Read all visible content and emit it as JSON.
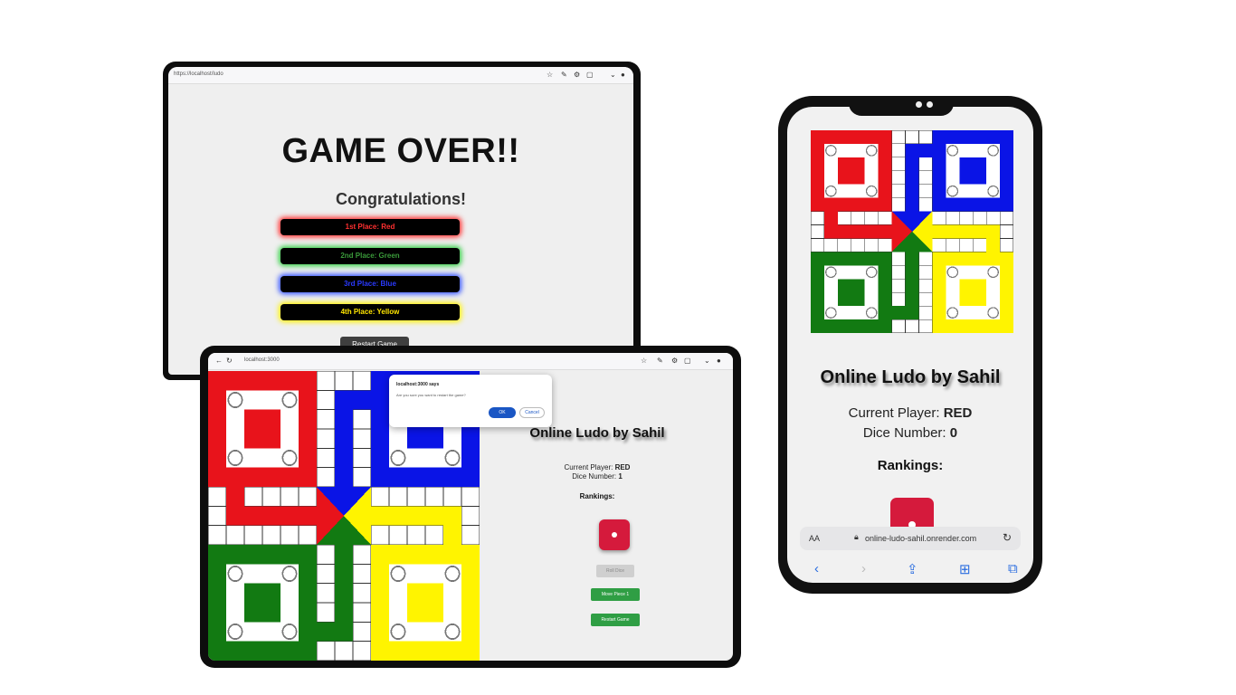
{
  "laptop": {
    "url": "https://localhost/ludo",
    "title": "GAME OVER!!",
    "subtitle": "Congratulations!",
    "rankings": [
      "1st Place: Red",
      "2nd Place: Green",
      "3rd Place: Blue",
      "4th Place: Yellow"
    ],
    "restart_label": "Restart Game"
  },
  "tablet": {
    "url": "localhost:3000",
    "dialog_title": "localhost:3000 says",
    "dialog_message": "Are you sure you want to restart the game?",
    "dialog_ok": "OK",
    "dialog_cancel": "Cancel",
    "title": "Online Ludo by Sahil",
    "player_label": "Current Player:",
    "player_value": "RED",
    "dice_label": "Dice Number:",
    "dice_value": "1",
    "rankings_label": "Rankings:",
    "roll_label": "Roll Dice",
    "move_label": "Move Piece 1",
    "restart_label": "Restart Game"
  },
  "phone": {
    "title": "Online Ludo by Sahil",
    "player_label": "Current Player:",
    "player_value": "RED",
    "dice_label": "Dice Number:",
    "dice_value": "0",
    "rankings_label": "Rankings:",
    "address_aa": "AA",
    "address_host": "online-ludo-sahil.onrender.com"
  },
  "colors": {
    "red": "#e8131b",
    "blue": "#0a14e6",
    "green": "#127a12",
    "yellow": "#fff400",
    "grey": "#8a8a8a"
  }
}
